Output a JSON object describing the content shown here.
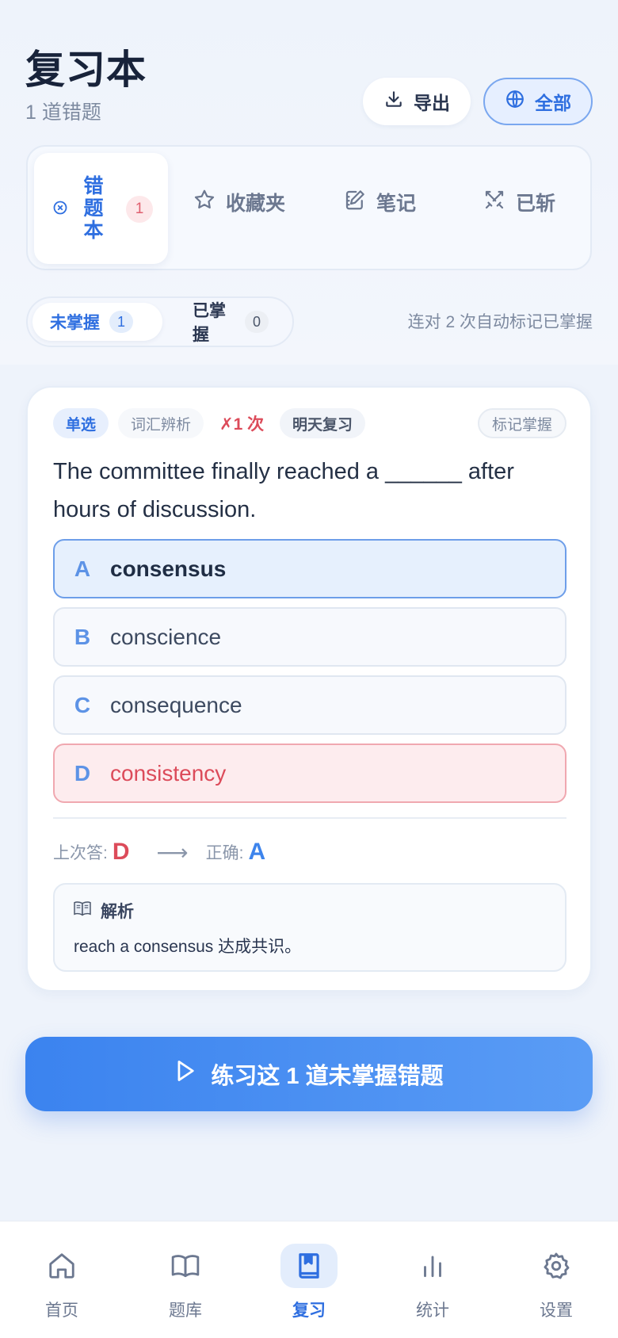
{
  "header": {
    "title": "复习本",
    "subtitle": "1 道错题",
    "export_label": "导出",
    "scope_label": "全部"
  },
  "tabs": {
    "wrong": {
      "label": "错题本",
      "chars": [
        "错",
        "题",
        "本"
      ],
      "count": "1"
    },
    "favorites": "收藏夹",
    "notes": "笔记",
    "cut": "已斩"
  },
  "filter": {
    "unmastered_label": "未掌握",
    "unmastered_count": "1",
    "mastered_label": "已掌握",
    "mastered_count": "0",
    "hint": "连对 2 次自动标记已掌握"
  },
  "question": {
    "type": "单选",
    "category": "词汇辨析",
    "error_count": "✗1 次",
    "next_review": "明天复习",
    "mark_label": "标记掌握",
    "text": "The committee finally reached a ______ after hours of discussion.",
    "options": [
      {
        "letter": "A",
        "text": "consensus",
        "state": "correct"
      },
      {
        "letter": "B",
        "text": "conscience",
        "state": "normal"
      },
      {
        "letter": "C",
        "text": "consequence",
        "state": "normal"
      },
      {
        "letter": "D",
        "text": "consistency",
        "state": "wrong"
      }
    ],
    "last_answer_label": "上次答:",
    "last_answer": "D",
    "arrow": "⟶",
    "correct_label": "正确:",
    "correct_answer": "A",
    "analysis_title": "解析",
    "analysis_text": "reach a consensus 达成共识。"
  },
  "practice_button": "练习这 1 道未掌握错题",
  "bottom_nav": [
    {
      "label": "首页",
      "icon": "home-icon"
    },
    {
      "label": "题库",
      "icon": "book-open-icon"
    },
    {
      "label": "复习",
      "icon": "bookmark-book-icon",
      "active": true
    },
    {
      "label": "统计",
      "icon": "bar-chart-icon"
    },
    {
      "label": "设置",
      "icon": "gear-icon"
    }
  ],
  "colors": {
    "accent": "#2f6fe0",
    "error": "#dc4b5a",
    "button_gradient_start": "#3b83ef",
    "button_gradient_end": "#5a9cf5"
  }
}
